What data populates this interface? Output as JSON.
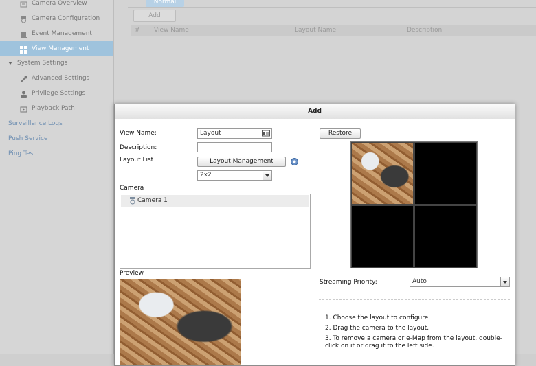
{
  "sidebar": {
    "items": [
      {
        "label": "Camera Overview",
        "icon": "camera-overview-icon"
      },
      {
        "label": "Camera Configuration",
        "icon": "camera-config-icon"
      },
      {
        "label": "Event Management",
        "icon": "event-icon"
      },
      {
        "label": "View Management",
        "icon": "view-icon",
        "active": true
      },
      {
        "label": "System Settings",
        "icon": "expand-triangle-icon"
      },
      {
        "label": "Advanced Settings",
        "icon": "wrench-icon"
      },
      {
        "label": "Privilege Settings",
        "icon": "user-icon"
      },
      {
        "label": "Playback Path",
        "icon": "playback-icon"
      },
      {
        "label": "Surveillance Logs"
      },
      {
        "label": "Push Service"
      },
      {
        "label": "Ping Test"
      }
    ]
  },
  "background": {
    "tab": "Normal",
    "add_button": "Add",
    "columns": [
      "#",
      "View Name",
      "Layout Name",
      "Description"
    ]
  },
  "dialog": {
    "title": "Add",
    "view_name_label": "View Name:",
    "view_name_value": "Layout",
    "description_label": "Description:",
    "description_value": "",
    "layout_list_label": "Layout List",
    "layout_management_button": "Layout Management",
    "layout_select_value": "2x2",
    "camera_section_label": "Camera",
    "camera_items": [
      "Camera 1"
    ],
    "preview_label": "Preview",
    "restore_button": "Restore",
    "streaming_priority_label": "Streaming Priority:",
    "streaming_priority_value": "Auto",
    "instructions": [
      "1. Choose the layout to configure.",
      "2. Drag the camera to the layout.",
      "3. To remove a camera or e-Map from the layout, double-",
      "click on it or drag it to the left side."
    ]
  },
  "colors": {
    "sidebar_active": "#9fc3dd",
    "link": "#6f8fb2",
    "dialog_bg": "#ffffff"
  }
}
